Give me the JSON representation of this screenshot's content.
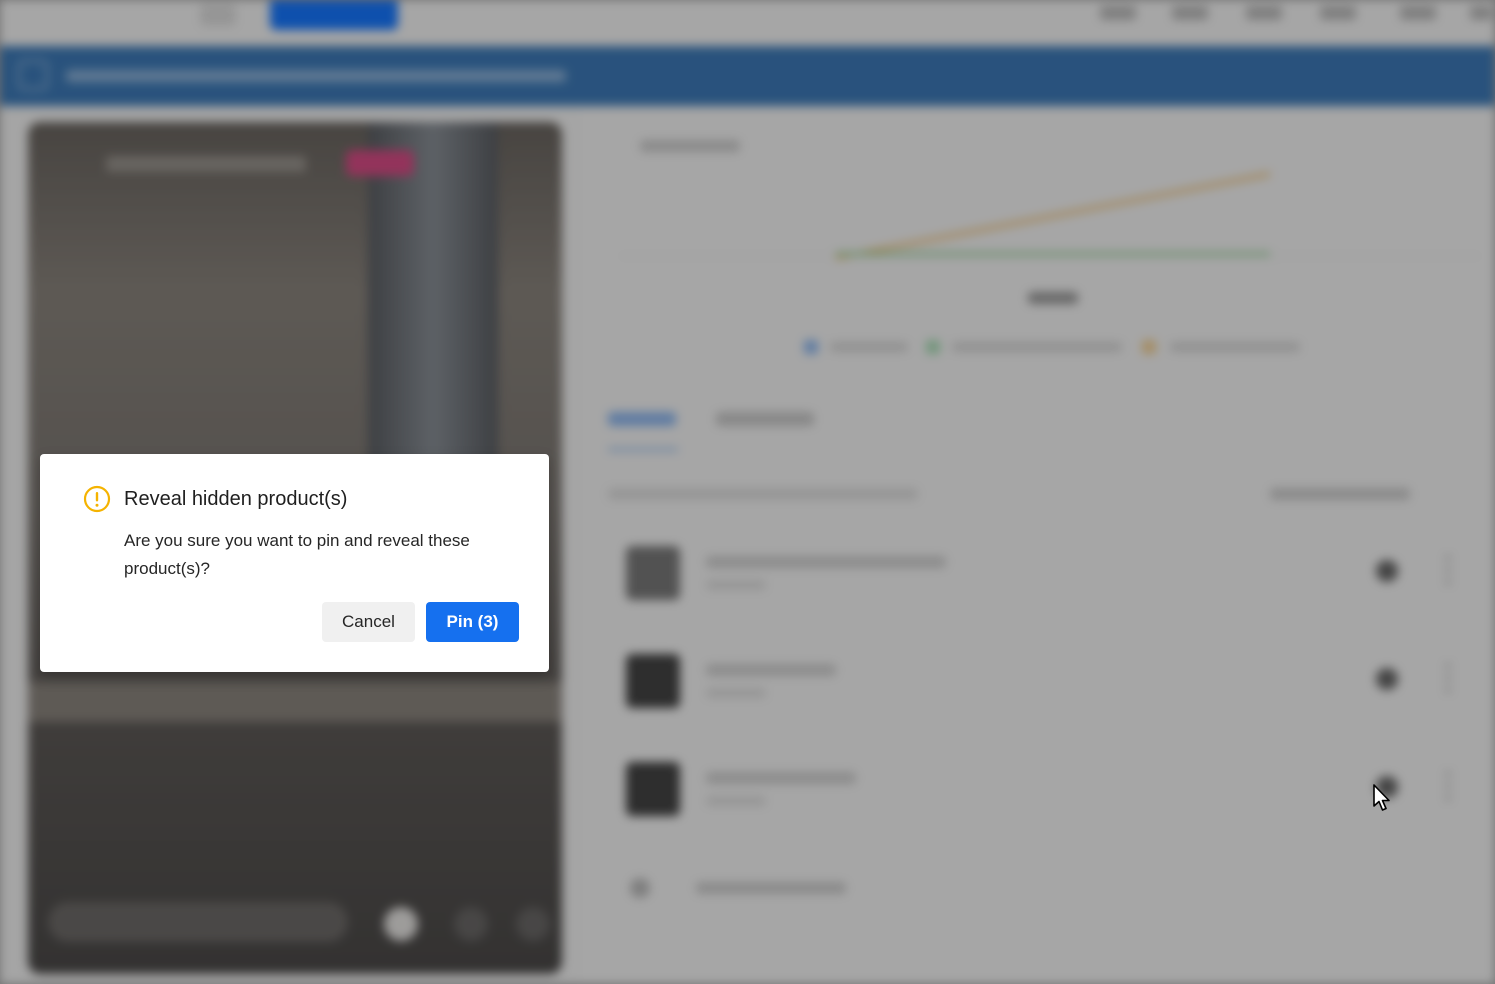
{
  "dialog": {
    "title": "Reveal hidden product(s)",
    "message": "Are you sure you want to pin and reveal these product(s)?",
    "cancel_label": "Cancel",
    "confirm_label": "Pin (3)",
    "icon": "warning-circle-icon"
  },
  "colors": {
    "warning": "#f5b300",
    "primary": "#1570ef",
    "banner": "#3d7ab8",
    "live_badge": "#d94c86",
    "chart_line_orange": "#f0c27a",
    "chart_line_green": "#9fd3a0"
  },
  "background": {
    "product_rows": 3,
    "icons": [
      "pin-icon",
      "more-vertical-icon",
      "plus-icon"
    ]
  }
}
